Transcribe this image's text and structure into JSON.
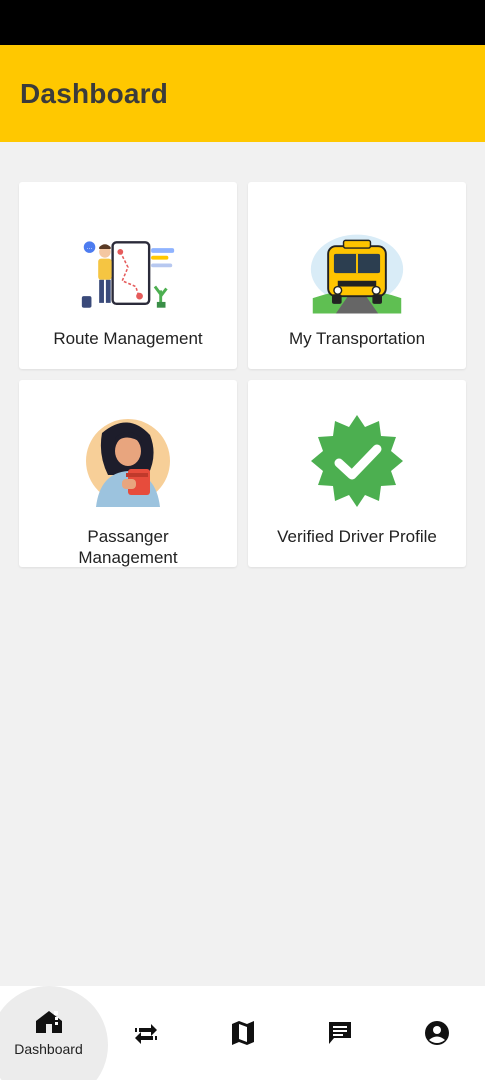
{
  "header": {
    "title": "Dashboard"
  },
  "cards": [
    {
      "label": "Route Management",
      "icon": "route-map-illustration"
    },
    {
      "label": "My Transportation",
      "icon": "school-bus-illustration"
    },
    {
      "label_line1": "Passanger",
      "label_line2": "Management",
      "icon": "passenger-avatar-illustration"
    },
    {
      "label": "Verified Driver Profile",
      "icon": "verified-badge-icon"
    }
  ],
  "bottom_nav": {
    "items": [
      {
        "label": "Dashboard",
        "icon": "home-icon",
        "active": true
      },
      {
        "label": "",
        "icon": "swap-arrows-icon"
      },
      {
        "label": "",
        "icon": "map-icon"
      },
      {
        "label": "",
        "icon": "chat-icon"
      },
      {
        "label": "",
        "icon": "account-circle-icon"
      }
    ]
  },
  "colors": {
    "accent": "#ffc800",
    "verified_green": "#4caf50",
    "background": "#f1f1f1"
  }
}
